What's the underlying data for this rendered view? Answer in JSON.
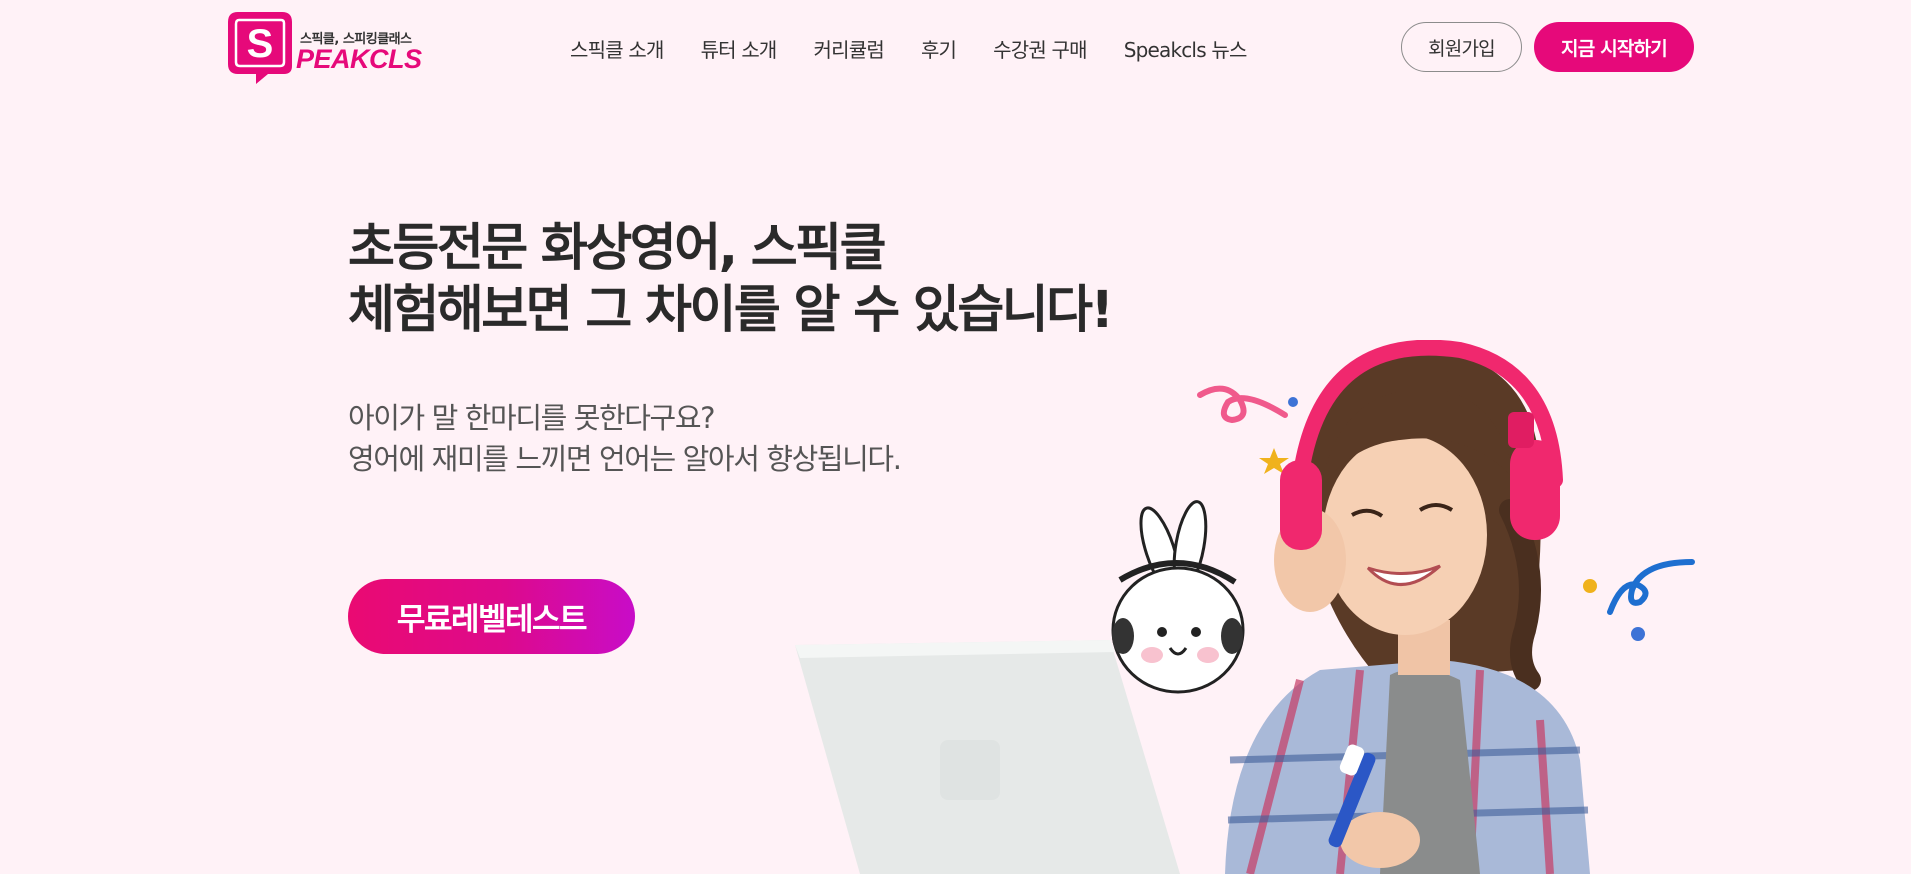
{
  "header": {
    "logo": {
      "tagline": "스픽클, 스피킹클래스",
      "wordmark": "PEAKCLS",
      "icon": "speech-bubble-s-icon"
    },
    "nav": [
      {
        "label": "스픽클 소개"
      },
      {
        "label": "튜터 소개"
      },
      {
        "label": "커리큘럼"
      },
      {
        "label": "후기"
      },
      {
        "label": "수강권 구매"
      },
      {
        "label": "Speakcls 뉴스"
      }
    ],
    "signup_label": "회원가입",
    "start_label": "지금 시작하기"
  },
  "hero": {
    "title_line1": "초등전문 화상영어, 스픽클",
    "title_line2": "체험해보면 그 차이를 알 수 있습니다!",
    "subtitle_line1": "아이가 말 한마디를 못한다구요?",
    "subtitle_line2": "영어에 재미를 느끼면 언어는 알아서 향상됩니다.",
    "cta_label": "무료레벨테스트"
  },
  "colors": {
    "brand": "#e6097a",
    "background": "#fff2f7",
    "cta_gradient_end": "#c80cc8"
  }
}
